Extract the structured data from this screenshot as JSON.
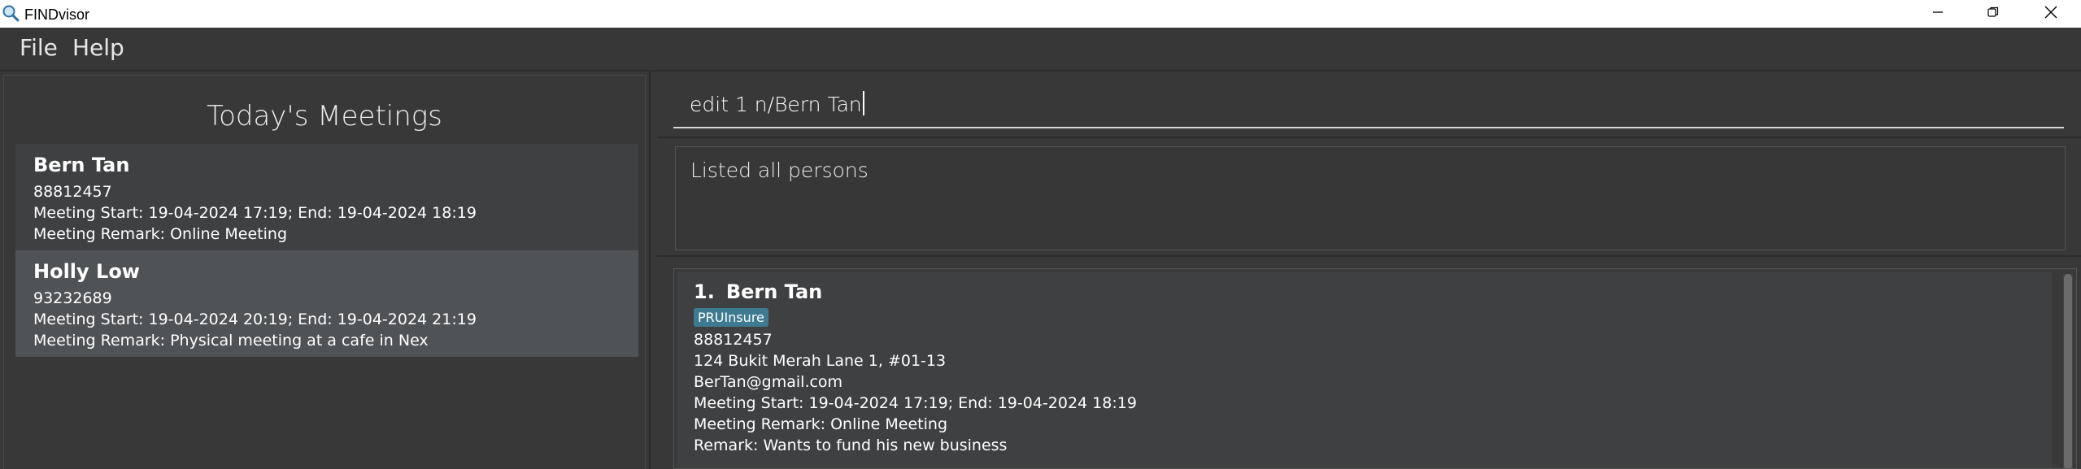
{
  "window": {
    "title": "FINDvisor",
    "icon": "search-icon",
    "controls": [
      "minimize-icon",
      "restore-icon",
      "close-icon"
    ]
  },
  "menu": {
    "file": "File",
    "help": "Help"
  },
  "meetings": {
    "title": "Today's Meetings",
    "items": [
      {
        "name": "Bern Tan",
        "phone": "88812457",
        "time": "Meeting Start: 19-04-2024 17:19; End: 19-04-2024 18:19",
        "remark": "Meeting Remark: Online Meeting",
        "selected": false
      },
      {
        "name": "Holly Low",
        "phone": "93232689",
        "time": "Meeting Start: 19-04-2024 20:19; End: 19-04-2024 21:19",
        "remark": "Meeting Remark: Physical meeting at a cafe in Nex",
        "selected": true
      }
    ]
  },
  "command": {
    "value": "edit 1 n/Bern Tan"
  },
  "result": {
    "message": "Listed all persons"
  },
  "persons": [
    {
      "index": "1.",
      "name": "Bern Tan",
      "tag": "PRUInsure",
      "phone": "88812457",
      "address": "124 Bukit Merah Lane 1, #01-13",
      "email": "BerTan@gmail.com",
      "meeting": "Meeting Start: 19-04-2024 17:19; End: 19-04-2024 18:19",
      "meeting_remark": "Meeting Remark: Online Meeting",
      "remark": "Remark: Wants to fund his new business"
    }
  ],
  "colors": {
    "background": "#383838",
    "card": "#3f4042",
    "card_selected": "#505356",
    "tag": "#3e7b91",
    "text": "#ffffff"
  }
}
